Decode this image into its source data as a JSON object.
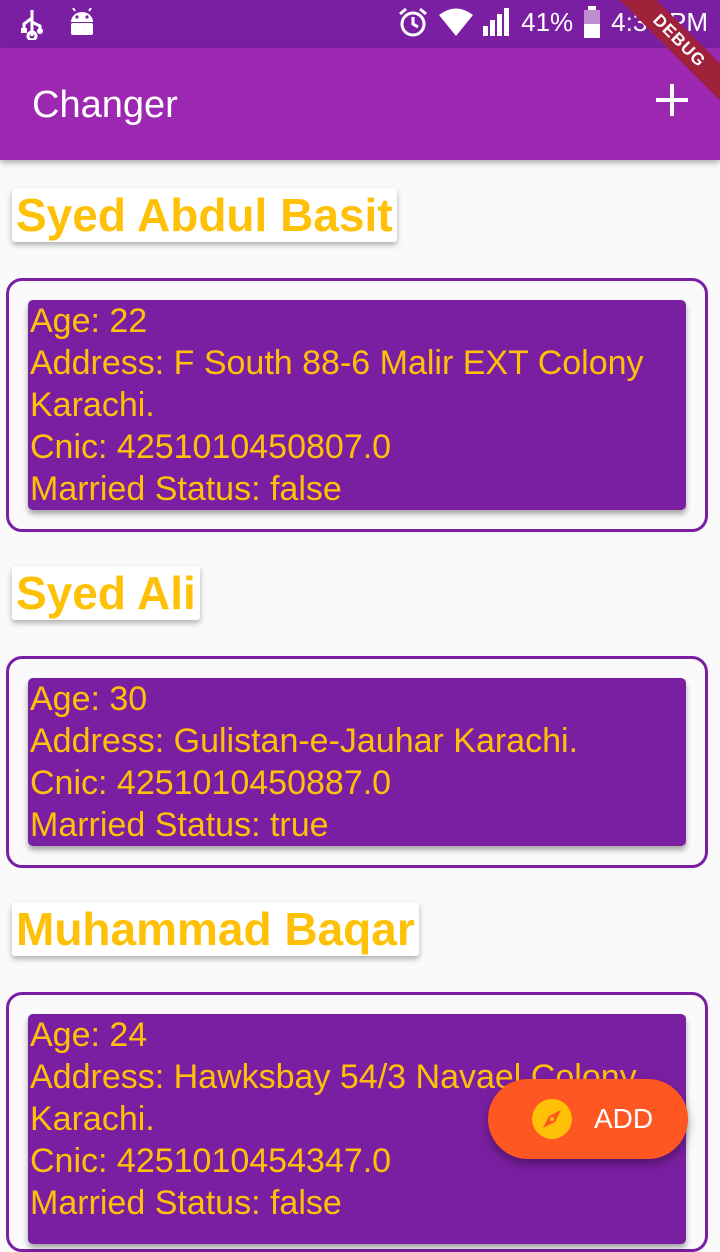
{
  "status_bar": {
    "battery": "41%",
    "time": "4:33 PM"
  },
  "app_bar": {
    "title": "Changer",
    "debug_label": "DEBUG"
  },
  "people": [
    {
      "name": "Syed Abdul Basit",
      "lines": [
        "Age: 22",
        "Address: F South 88-6 Malir EXT Colony",
        "Karachi.",
        "Cnic: 4251010450807.0",
        "Married Status: false"
      ]
    },
    {
      "name": "Syed Ali",
      "lines": [
        "Age: 30",
        "Address: Gulistan-e-Jauhar Karachi.",
        "Cnic: 4251010450887.0",
        "Married Status: true"
      ]
    },
    {
      "name": "Muhammad Baqar",
      "lines": [
        "Age: 24",
        "Address: Hawksbay 54/3 Navael Colony",
        "Karachi.",
        "Cnic: 4251010454347.0",
        "Married Status: false"
      ]
    }
  ],
  "fab": {
    "label": "ADD",
    "icon": "compass-icon"
  },
  "colors": {
    "primary": "#9c27b0",
    "primary_dark": "#7b1fa2",
    "accent_text": "#ffc107",
    "fab": "#ff5722"
  }
}
